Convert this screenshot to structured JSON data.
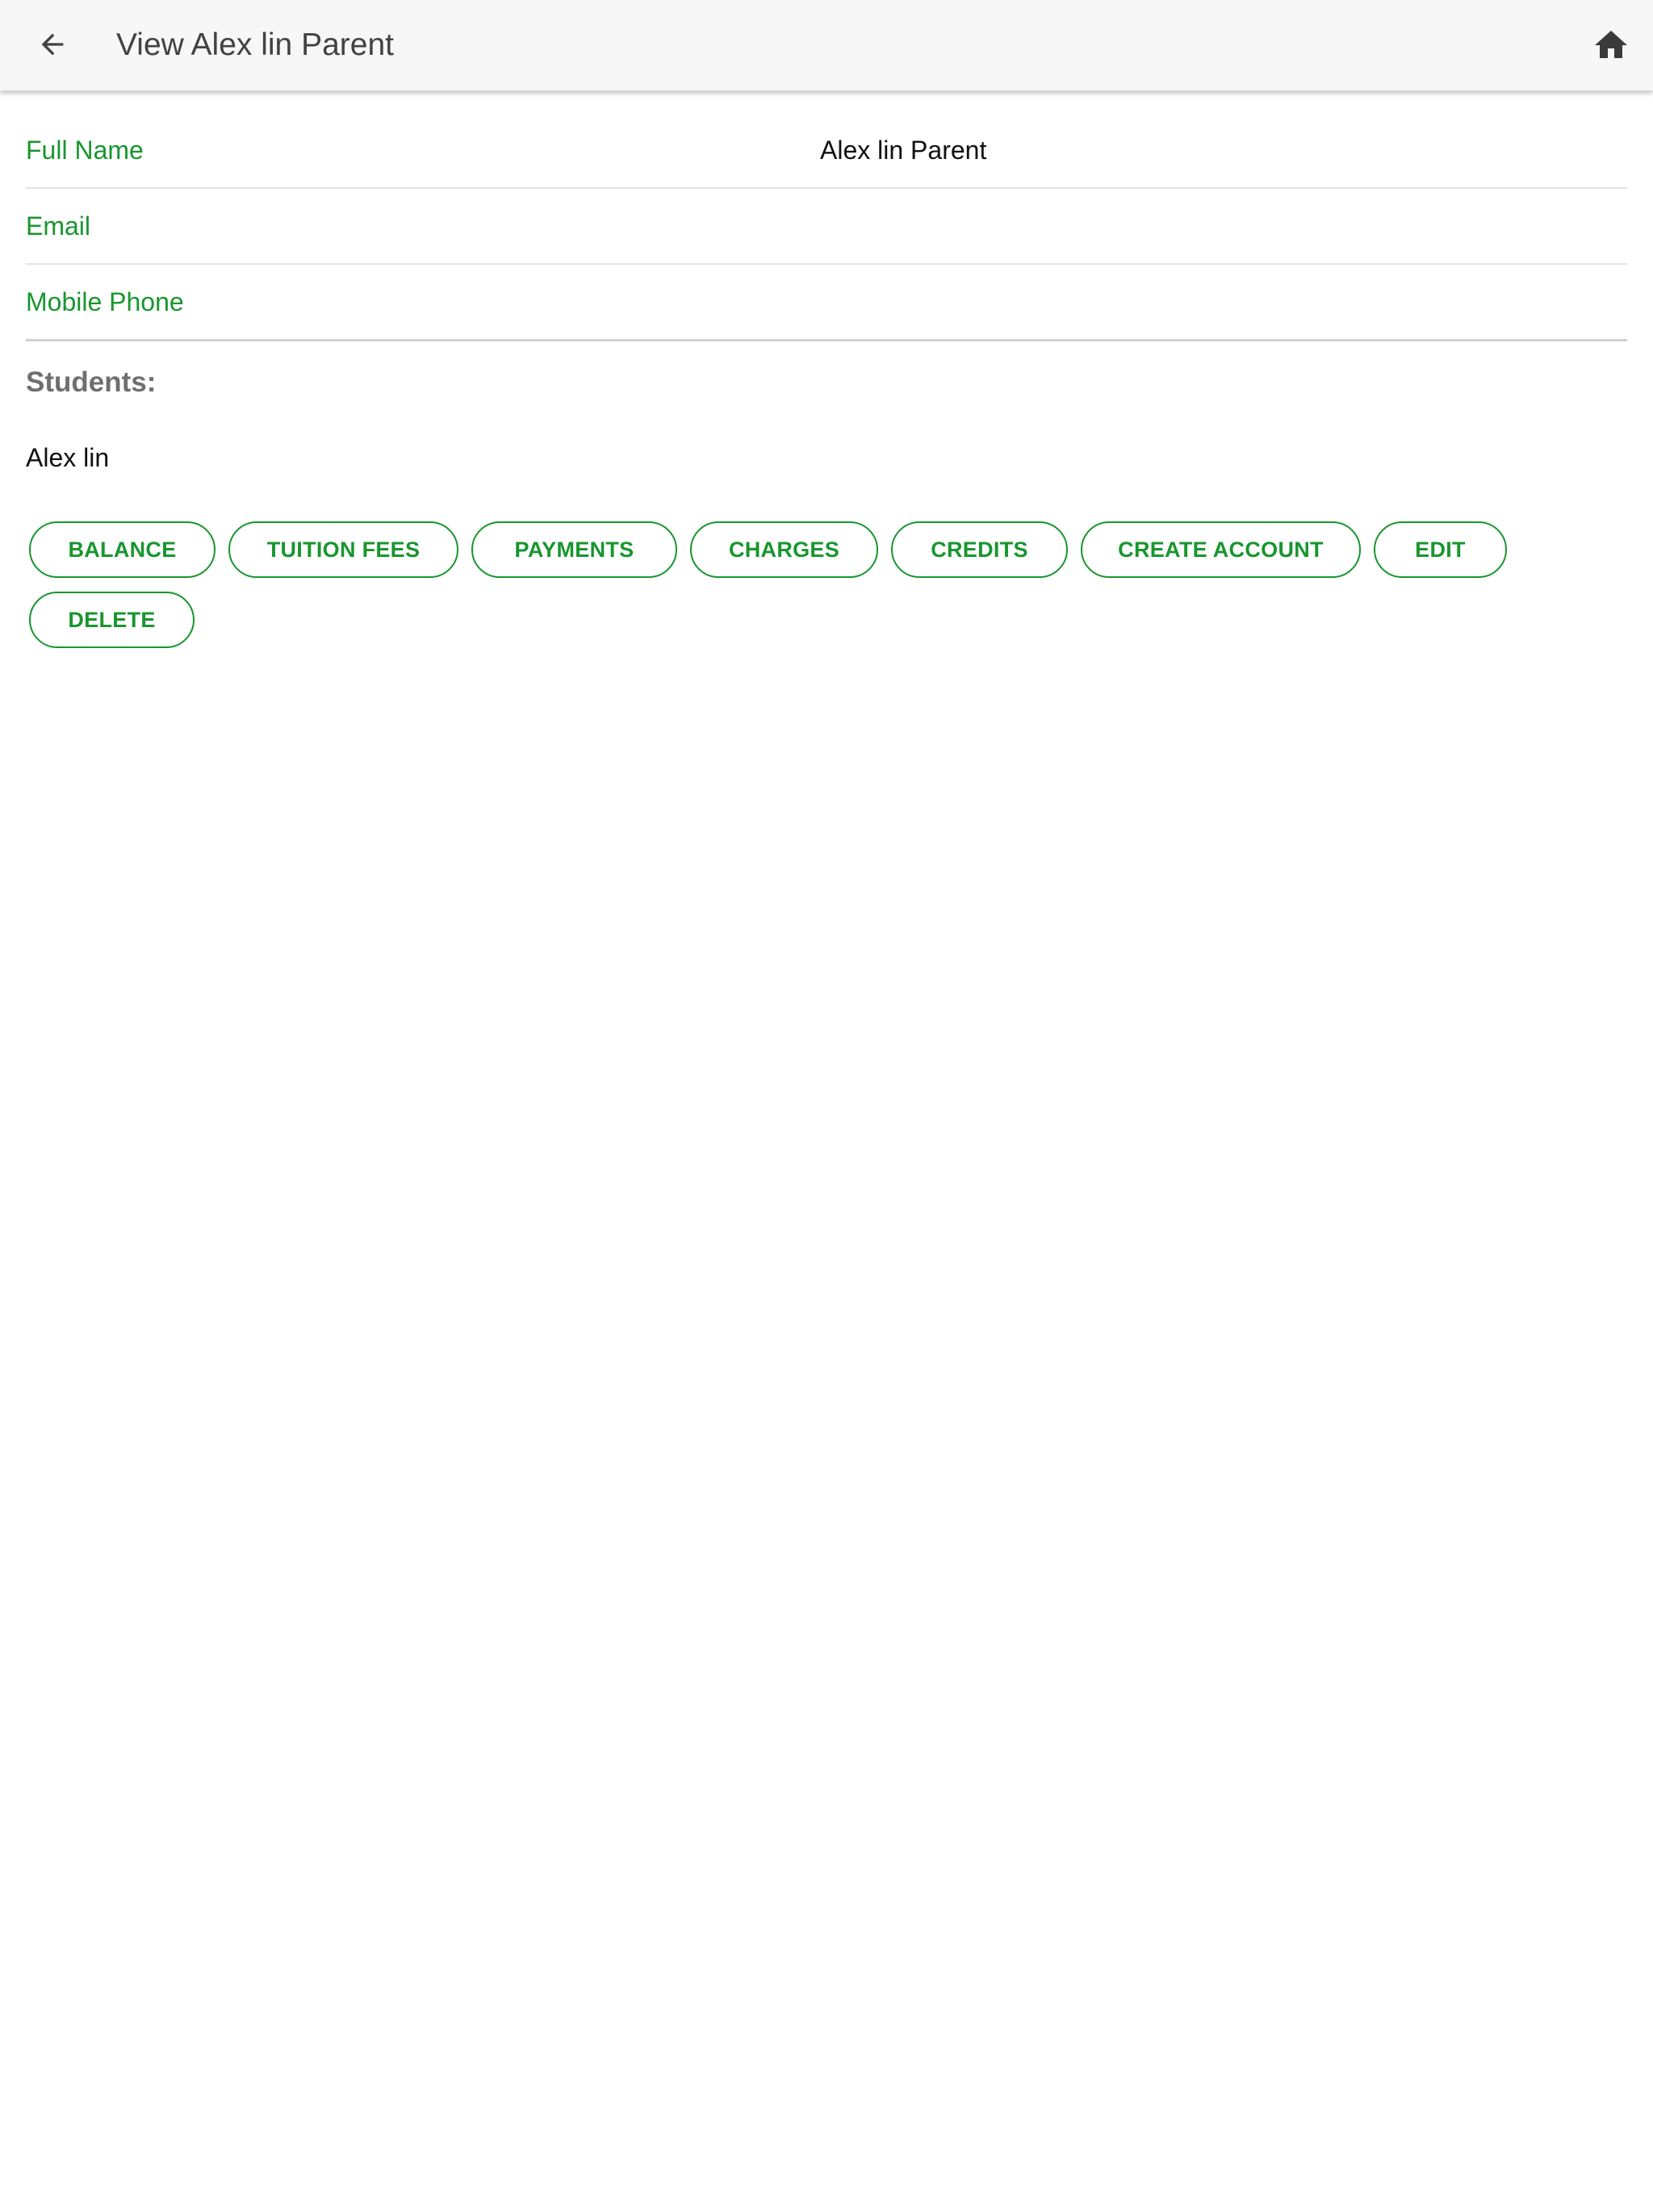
{
  "header": {
    "title": "View Alex lin Parent",
    "back_icon": "arrow-left-icon",
    "home_icon": "home-icon"
  },
  "fields": {
    "full_name": {
      "label": "Full Name",
      "value": "Alex lin Parent"
    },
    "email": {
      "label": "Email",
      "value": ""
    },
    "mobile_phone": {
      "label": "Mobile Phone",
      "value": ""
    }
  },
  "students": {
    "heading": "Students:",
    "items": [
      "Alex lin"
    ]
  },
  "actions": {
    "balance": "BALANCE",
    "tuition_fees": "TUITION FEES",
    "payments": "PAYMENTS",
    "charges": "CHARGES",
    "credits": "CREDITS",
    "create_account": "CREATE ACCOUNT",
    "edit": "EDIT",
    "delete": "DELETE"
  },
  "colors": {
    "accent": "#18962e",
    "toolbar_bg": "#f7f7f7",
    "title_text": "#424242",
    "heading_text": "#6f6f6f"
  }
}
